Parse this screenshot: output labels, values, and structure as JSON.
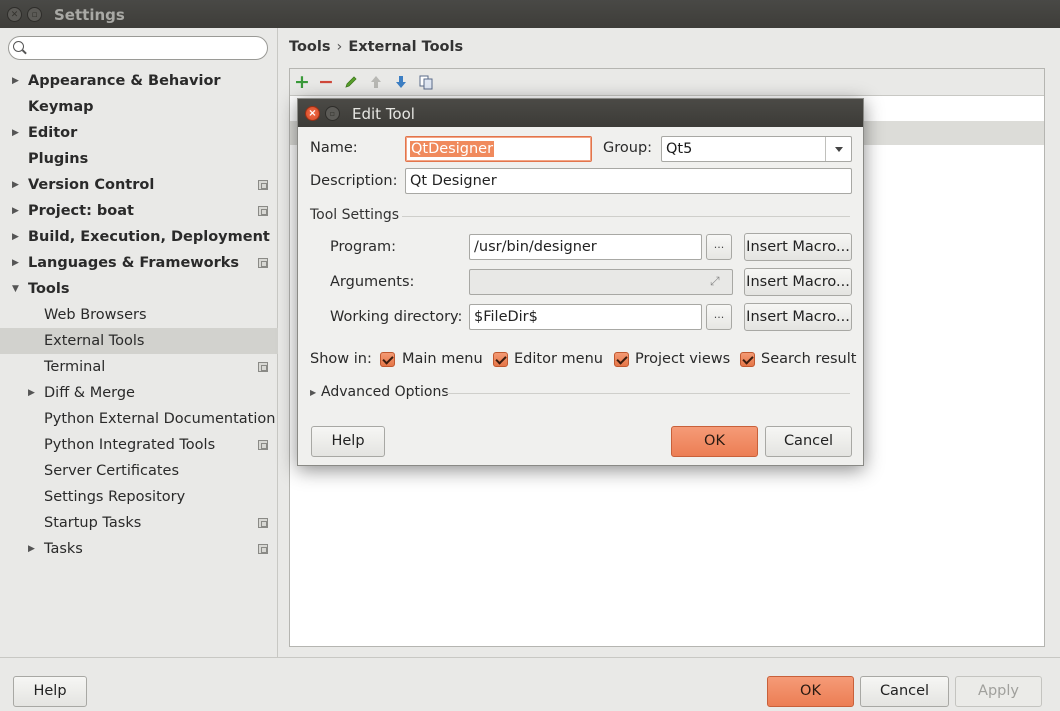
{
  "window": {
    "title": "Settings"
  },
  "sidebar": {
    "search_placeholder": "",
    "items": [
      {
        "label": "Appearance & Behavior",
        "bold": true,
        "arrow": "right"
      },
      {
        "label": "Keymap",
        "bold": true,
        "arrow": ""
      },
      {
        "label": "Editor",
        "bold": true,
        "arrow": "right"
      },
      {
        "label": "Plugins",
        "bold": true,
        "arrow": ""
      },
      {
        "label": "Version Control",
        "bold": true,
        "arrow": "right",
        "project": true
      },
      {
        "label": "Project: boat",
        "bold": true,
        "arrow": "right",
        "project": true
      },
      {
        "label": "Build, Execution, Deployment",
        "bold": true,
        "arrow": "right"
      },
      {
        "label": "Languages & Frameworks",
        "bold": true,
        "arrow": "right",
        "project": true
      },
      {
        "label": "Tools",
        "bold": true,
        "arrow": "down"
      },
      {
        "label": "Web Browsers",
        "arrow": ""
      },
      {
        "label": "External Tools",
        "arrow": "",
        "selected": true
      },
      {
        "label": "Terminal",
        "arrow": "",
        "project": true
      },
      {
        "label": "Diff & Merge",
        "arrow": "right"
      },
      {
        "label": "Python External Documentation",
        "arrow": ""
      },
      {
        "label": "Python Integrated Tools",
        "arrow": "",
        "project": true
      },
      {
        "label": "Server Certificates",
        "arrow": ""
      },
      {
        "label": "Settings Repository",
        "arrow": ""
      },
      {
        "label": "Startup Tasks",
        "arrow": "",
        "project": true
      },
      {
        "label": "Tasks",
        "arrow": "right",
        "project": true
      }
    ]
  },
  "breadcrumb": {
    "parent": "Tools",
    "separator": "›",
    "current": "External Tools"
  },
  "toolbar": {
    "icons": [
      "add-icon",
      "remove-icon",
      "edit-icon",
      "move-up-icon",
      "move-down-icon",
      "copy-icon"
    ],
    "add_glyph": "+",
    "remove_glyph": "−"
  },
  "footer": {
    "help": "Help",
    "ok": "OK",
    "cancel": "Cancel",
    "apply": "Apply"
  },
  "dialog": {
    "title": "Edit Tool",
    "name_label": "Name:",
    "name_value": "QtDesigner",
    "group_label": "Group:",
    "group_value": "Qt5",
    "description_label": "Description:",
    "description_value": "Qt Designer",
    "tool_settings": "Tool Settings",
    "program_label": "Program:",
    "program_value": "/usr/bin/designer",
    "arguments_label": "Arguments:",
    "arguments_value": "",
    "workdir_label": "Working directory:",
    "workdir_value": "$FileDir$",
    "browse": "...",
    "insert_macro": "Insert Macro...",
    "show_in_label": "Show in:",
    "show_in": [
      {
        "label": "Main menu",
        "checked": true
      },
      {
        "label": "Editor menu",
        "checked": true
      },
      {
        "label": "Project views",
        "checked": true
      },
      {
        "label": "Search result",
        "checked": true
      }
    ],
    "advanced": "Advanced Options",
    "help": "Help",
    "ok": "OK",
    "cancel": "Cancel"
  },
  "colors": {
    "accent": "#ec7e54",
    "selection": "#d2d2ce",
    "titlebar": "#3e3d39"
  }
}
